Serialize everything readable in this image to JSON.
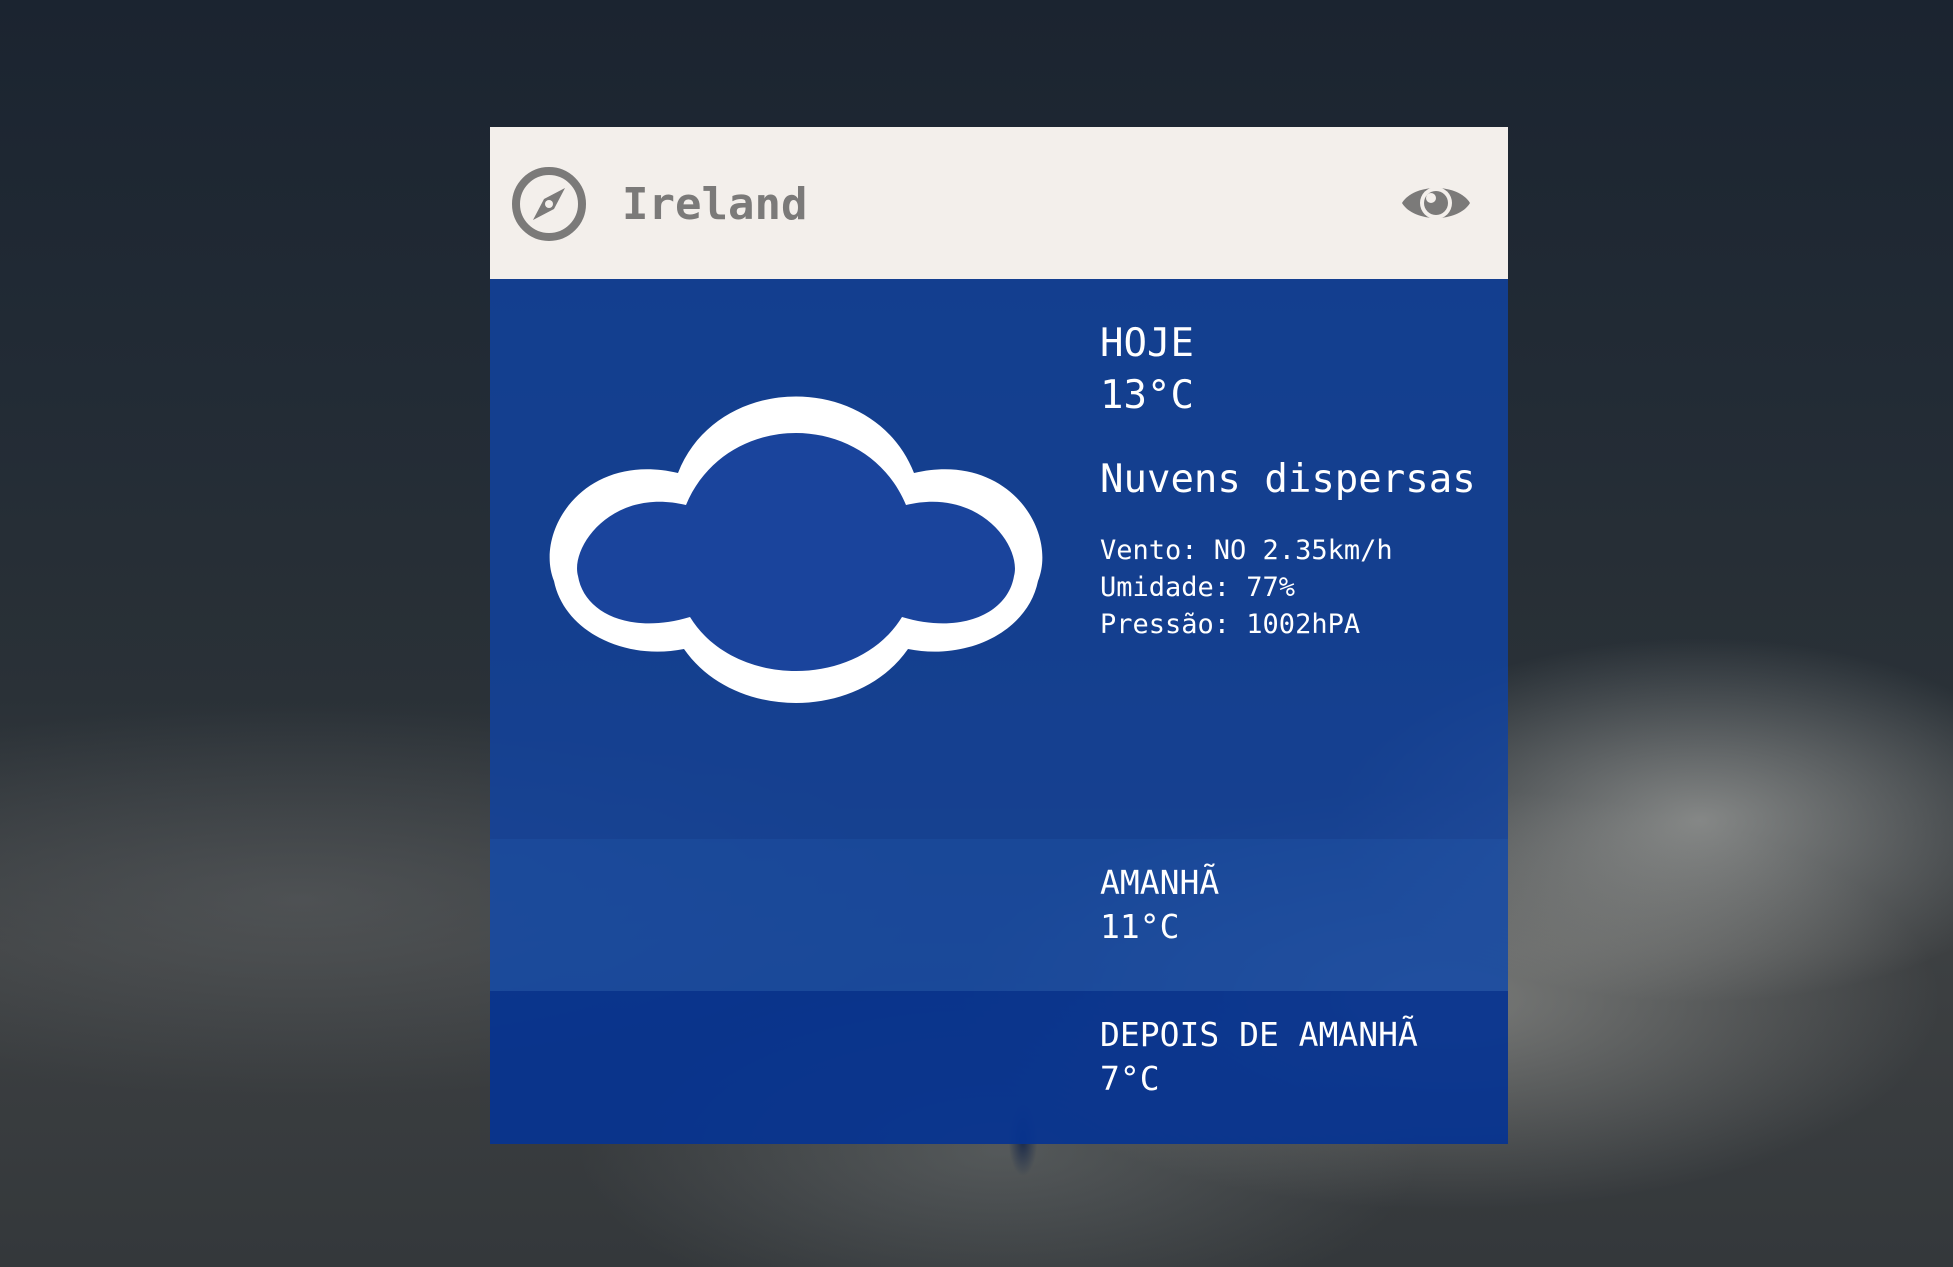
{
  "header": {
    "location": "Ireland",
    "left_icon": "compass-icon",
    "right_icon": "eye-icon"
  },
  "today": {
    "label": "HOJE",
    "temperature": "13°C",
    "condition": "Nuvens dispersas",
    "condition_icon": "cloud-icon",
    "wind": "Vento: NO 2.35km/h",
    "humidity": "Umidade: 77%",
    "pressure": "Pressão: 1002hPA"
  },
  "tomorrow": {
    "label": "AMANHÃ",
    "temperature": "11°C"
  },
  "day_after": {
    "label": "DEPOIS DE AMANHÃ",
    "temperature": "7°C"
  },
  "colors": {
    "header_bg": "#f3efeb",
    "header_text": "#7b7a79",
    "panel_blue": "#12429e",
    "text_white": "#ffffff"
  }
}
